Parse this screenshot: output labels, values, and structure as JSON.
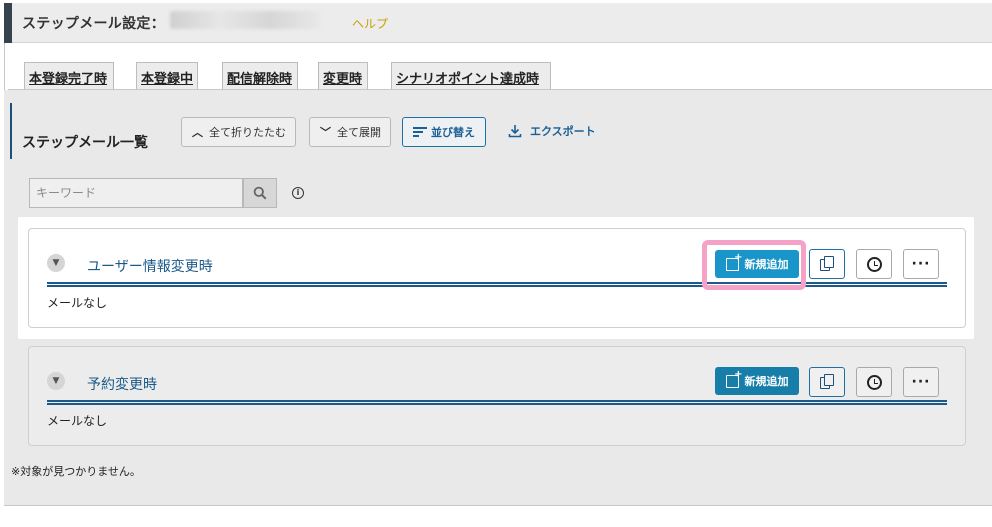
{
  "header": {
    "title": "ステップメール設定：",
    "help": "ヘルプ"
  },
  "tabs": [
    {
      "label": "本登録完了時"
    },
    {
      "label": "本登録中"
    },
    {
      "label": "配信解除時"
    },
    {
      "label": "変更時"
    },
    {
      "label": "シナリオポイント達成時"
    }
  ],
  "list": {
    "title": "ステップメール一覧",
    "collapse_all": "全て折りたたむ",
    "expand_all": "全て展開",
    "sort": "並び替え",
    "export": "エクスポート"
  },
  "search": {
    "placeholder": "キーワード"
  },
  "groups": [
    {
      "title": "ユーザー情報変更時",
      "empty": "メールなし",
      "new_label": "新規追加"
    },
    {
      "title": "予約変更時",
      "empty": "メールなし",
      "new_label": "新規追加"
    }
  ],
  "not_found": "※対象が見つかりません。",
  "colors": {
    "accent": "#1995c9",
    "link": "#1a5f96",
    "help": "#c7a100",
    "highlight": "#f4a3c6"
  }
}
